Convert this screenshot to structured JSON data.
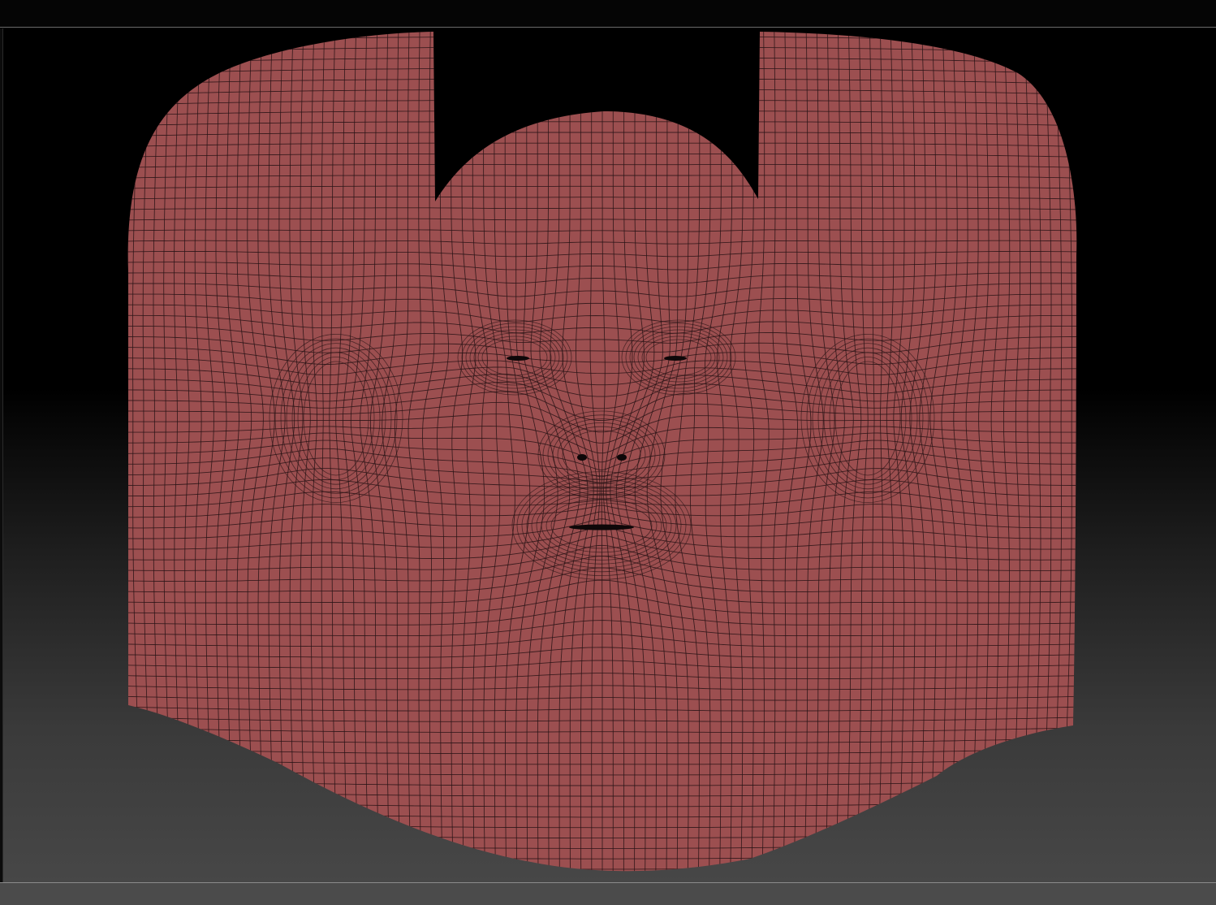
{
  "viewport": {
    "content": "uv-mesh-layout",
    "mesh_fill": "#9c4f50",
    "wire_color": "#2a1416",
    "hole_color": "#0e0708",
    "bg_top": "#000000",
    "bg_bottom": "#474747",
    "frame_line": "#6a6a6a"
  }
}
